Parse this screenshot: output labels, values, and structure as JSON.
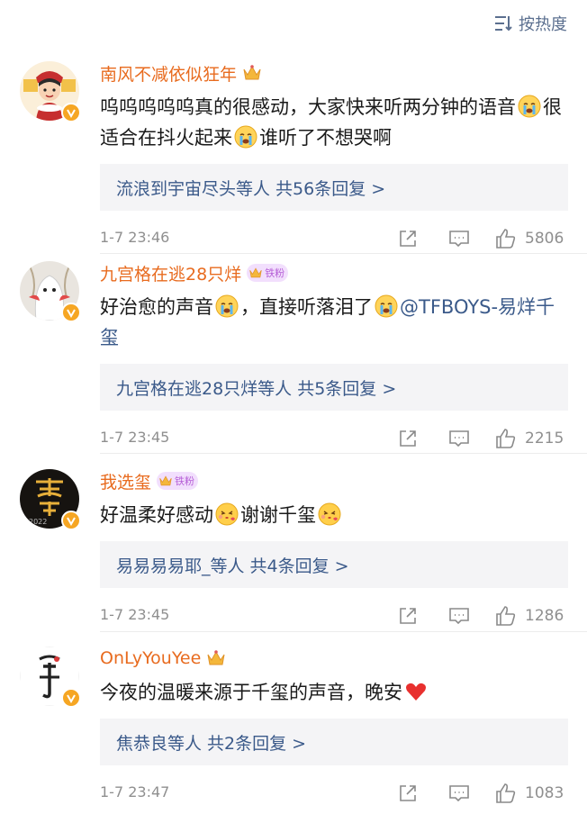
{
  "sort": {
    "label": "按热度"
  },
  "comments": [
    {
      "username": "南风不减依似狂年",
      "fan_badge": "",
      "text": [
        "呜呜呜呜呜真的很感动，大家快来听两分钟的语音",
        "[cry]",
        "很适合在抖火起来",
        "[cry]",
        "谁听了不想哭啊"
      ],
      "replies": "流浪到宇宙尽头等人 共56条回复 >",
      "time": "1-7 23:46",
      "likes": "5806"
    },
    {
      "username": "九宫格在逃28只烊",
      "fan_badge": "铁粉",
      "text": [
        "好治愈的声音",
        "[cry]",
        "，直接听落泪了",
        "[cry]",
        "@TFBOYS-易烊千玺"
      ],
      "replies": "九宫格在逃28只烊等人 共5条回复 >",
      "time": "1-7 23:45",
      "likes": "2215"
    },
    {
      "username": "我选玺",
      "fan_badge": "铁粉",
      "text": [
        "好温柔好感动",
        "[kiss]",
        "谢谢千玺",
        "[kiss]"
      ],
      "replies": "易易易易耶_等人 共4条回复 >",
      "time": "1-7 23:45",
      "likes": "1286"
    },
    {
      "username": "OnLyYouYee",
      "fan_badge": "",
      "text": [
        "今夜的温暖来源于千玺的声音，晚安",
        "[heart]"
      ],
      "replies": "焦恭良等人 共2条回复 >",
      "time": "1-7 23:47",
      "likes": "1083"
    }
  ],
  "avatar_overlay_text": {
    "c3": "2022"
  },
  "colors": {
    "username": "#e86b1f",
    "link": "#3b5a8a",
    "meta": "#8f8f8f",
    "reply_bg": "#f4f4f6",
    "vip_badge": "#f6a623"
  },
  "icons": [
    "sort-icon",
    "crown-icon",
    "verified-badge-icon",
    "share-icon",
    "comment-icon",
    "like-icon",
    "crying-emoji-icon",
    "kiss-emoji-icon",
    "heart-emoji-icon"
  ]
}
